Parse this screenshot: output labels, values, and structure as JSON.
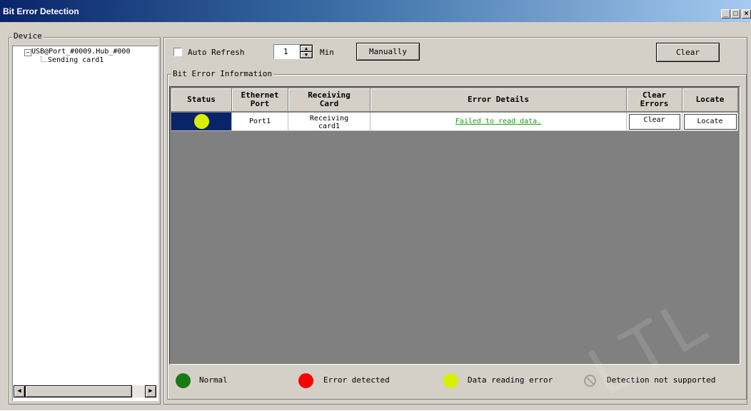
{
  "window": {
    "title": "Bit Error Detection",
    "min_label": "_",
    "max_label": "□",
    "close_label": "×"
  },
  "device": {
    "label": "Device",
    "tree": {
      "expander": "−",
      "root": "USB@Port_#0009.Hub_#000",
      "child": "Sending card1"
    }
  },
  "toolbar": {
    "auto_refresh_label": "Auto Refresh",
    "interval_value": "1",
    "unit_label": "Min",
    "manually_label": "Manually",
    "clear_label": "Clear"
  },
  "info": {
    "label": "Bit Error Information",
    "headers": {
      "status": "Status",
      "eth1": "Ethernet",
      "eth2": "Port",
      "rc1": "Receiving",
      "rc2": "Card",
      "details": "Error Details",
      "ce1": "Clear",
      "ce2": "Errors",
      "locate": "Locate"
    },
    "rows": [
      {
        "status_color": "#d7f000",
        "port": "Port1",
        "card1": "Receiving",
        "card2": "card1",
        "details": "Failed to read data.",
        "clear": "Clear",
        "locate": "Locate"
      }
    ]
  },
  "legend": [
    {
      "color": "#1a7a14",
      "label": "Normal"
    },
    {
      "color": "#ff0000",
      "label": "Error detected"
    },
    {
      "color": "#d7f000",
      "label": "Data reading error"
    },
    {
      "color": "#a0a0a0",
      "label": "Detection not supported"
    }
  ],
  "watermark": "LTL"
}
